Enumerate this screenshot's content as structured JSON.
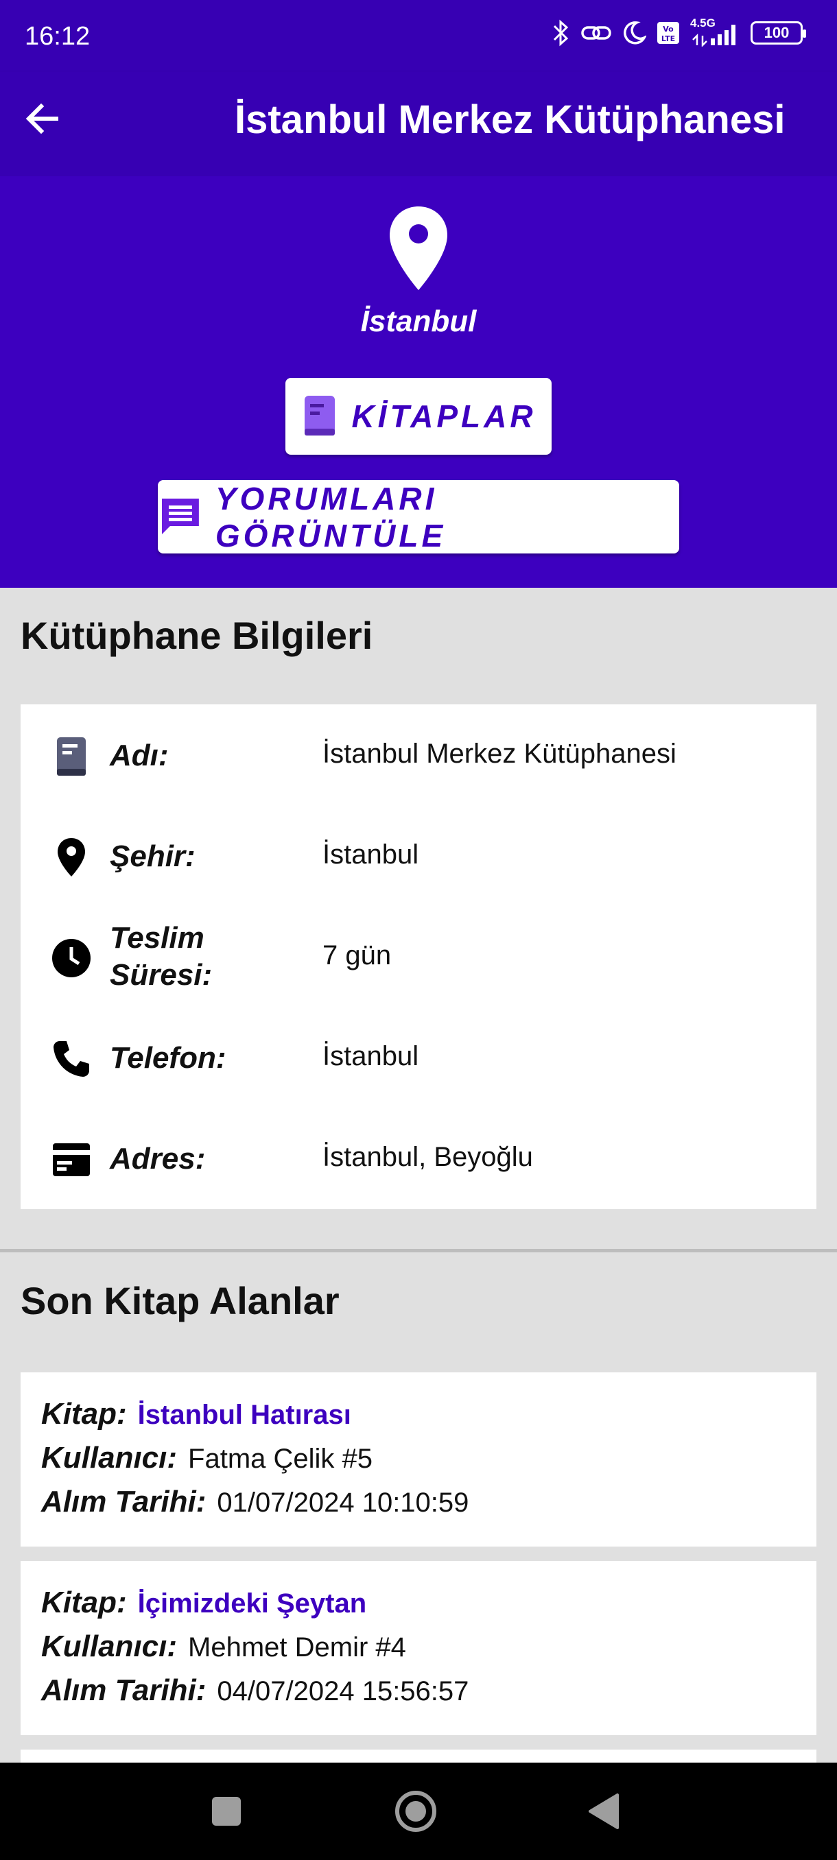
{
  "status": {
    "time": "16:12",
    "network": "4.5G",
    "battery": "100"
  },
  "header": {
    "title": "İstanbul Merkez Kütüphanesi",
    "back_icon": "arrow-back-icon"
  },
  "hero": {
    "city": "İstanbul",
    "books_button": "KİTAPLAR",
    "comments_button": "YORUMLARI GÖRÜNTÜLE",
    "accent": "#3d00bf"
  },
  "info": {
    "section_title": "Kütüphane Bilgileri",
    "rows": [
      {
        "icon": "book-icon",
        "label": "Adı:",
        "value": "İstanbul Merkez Kütüphanesi"
      },
      {
        "icon": "location-pin-icon",
        "label": "Şehir:",
        "value": "İstanbul"
      },
      {
        "icon": "clock-icon",
        "label_line1": "Teslim",
        "label_line2": "Süresi:",
        "value": "7 gün"
      },
      {
        "icon": "phone-icon",
        "label": "Telefon:",
        "value": "İstanbul"
      },
      {
        "icon": "address-card-icon",
        "label": "Adres:",
        "value": "İstanbul, Beyoğlu"
      }
    ]
  },
  "loans": {
    "section_title": "Son Kitap Alanlar",
    "book_label": "Kitap:",
    "user_label": "Kullanıcı:",
    "date_label": "Alım Tarihi:",
    "items": [
      {
        "book": "İstanbul Hatırası",
        "user": "Fatma Çelik #5",
        "date": "01/07/2024 10:10:59"
      },
      {
        "book": "İçimizdeki Şeytan",
        "user": "Mehmet Demir #4",
        "date": "04/07/2024 15:56:57"
      }
    ]
  }
}
